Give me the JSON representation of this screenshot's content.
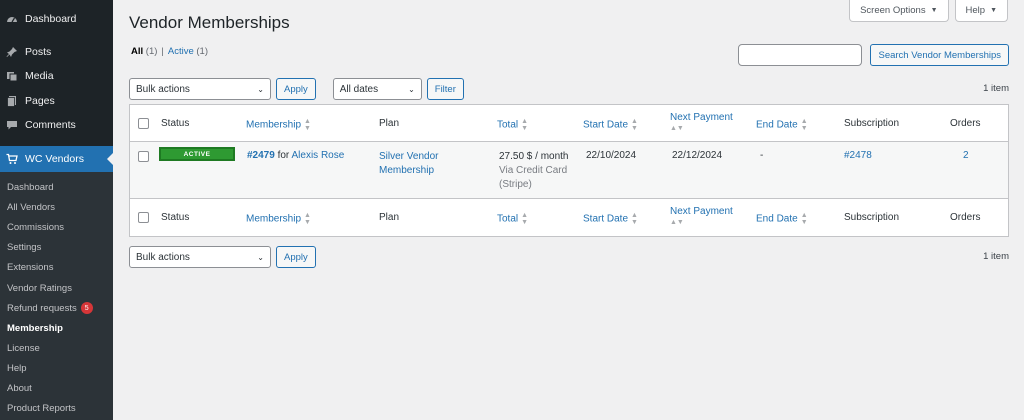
{
  "sidebar": {
    "top": [
      {
        "label": "Dashboard",
        "icon": "dashboard-icon"
      },
      {
        "label": "Posts",
        "icon": "pin-icon"
      },
      {
        "label": "Media",
        "icon": "media-icon"
      },
      {
        "label": "Pages",
        "icon": "pages-icon"
      },
      {
        "label": "Comments",
        "icon": "comment-icon"
      },
      {
        "label": "WC Vendors",
        "icon": "cart-icon"
      }
    ],
    "submenu": [
      {
        "label": "Dashboard"
      },
      {
        "label": "All Vendors"
      },
      {
        "label": "Commissions"
      },
      {
        "label": "Settings"
      },
      {
        "label": "Extensions"
      },
      {
        "label": "Vendor Ratings"
      },
      {
        "label": "Refund requests",
        "badge": "5"
      },
      {
        "label": "Membership"
      },
      {
        "label": "License"
      },
      {
        "label": "Help"
      },
      {
        "label": "About"
      },
      {
        "label": "Product Reports"
      }
    ]
  },
  "screen_meta": {
    "screen_options": "Screen Options",
    "help": "Help"
  },
  "page": {
    "title": "Vendor Memberships"
  },
  "views": {
    "all_label": "All",
    "all_count": "(1)",
    "separator": "|",
    "active_label": "Active",
    "active_count": "(1)"
  },
  "search": {
    "value": "",
    "button": "Search Vendor Memberships"
  },
  "tablenav": {
    "bulk_actions": "Bulk actions",
    "apply": "Apply",
    "dates": "All dates",
    "filter": "Filter",
    "items": "1 item"
  },
  "columns": {
    "status": "Status",
    "membership": "Membership",
    "plan": "Plan",
    "total": "Total",
    "start_date": "Start Date",
    "next_payment": "Next Payment",
    "end_date": "End Date",
    "subscription": "Subscription",
    "orders": "Orders"
  },
  "rows": [
    {
      "status": "ACTIVE",
      "membership_id": "#2479",
      "membership_for": "for",
      "member_name": "Alexis Rose",
      "plan_line1": "Silver Vendor",
      "plan_line2": "Membership",
      "total": "27.50 $ / month",
      "payment_line1": "Via Credit Card",
      "payment_line2": "(Stripe)",
      "start_date": "22/10/2024",
      "next_payment": "22/12/2024",
      "end_date": "-",
      "subscription": "#2478",
      "orders": "2"
    }
  ],
  "colors": {
    "sidebar": "#1d2327",
    "accent": "#2271b1",
    "active_status": "#2e9a32"
  }
}
